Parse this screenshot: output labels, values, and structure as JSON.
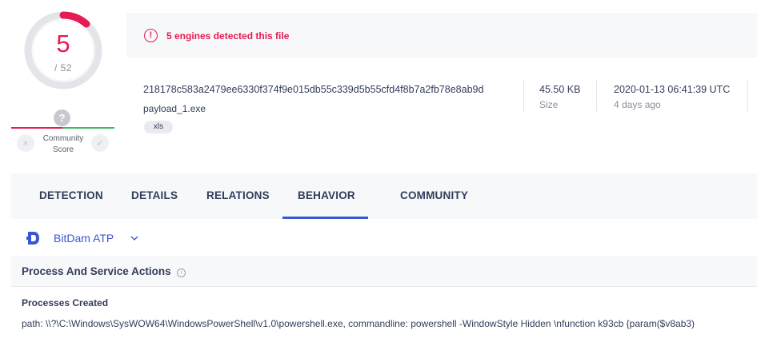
{
  "score": {
    "detections": "5",
    "total": "/ 52",
    "accent": "#e41c53"
  },
  "community": {
    "help_glyph": "?",
    "label_line1": "Community",
    "label_line2": "Score",
    "down_icon": "×",
    "up_icon": "✓"
  },
  "banner": {
    "icon": "!",
    "text": "5 engines detected this file",
    "color": "#e41c53"
  },
  "file": {
    "hash": "218178c583a2479ee6330f374f9e015db55c339d5b55cfd4f8b7a2fb78e8ab9d",
    "name": "payload_1.exe",
    "tag": "xls",
    "size_value": "45.50 KB",
    "size_label": "Size",
    "date_value": "2020-01-13 06:41:39 UTC",
    "date_relative": "4 days ago"
  },
  "tabs": [
    {
      "label": "DETECTION",
      "active": false
    },
    {
      "label": "DETAILS",
      "active": false
    },
    {
      "label": "RELATIONS",
      "active": false
    },
    {
      "label": "BEHAVIOR",
      "active": true
    },
    {
      "label": "COMMUNITY",
      "active": false
    }
  ],
  "sandbox": {
    "name": "BitDam ATP",
    "icon": "bitdam-logo-icon",
    "color": "#3a57d3"
  },
  "section": {
    "title": "Process And Service Actions",
    "info_glyph": "i",
    "subtitle": "Processes Created",
    "path_text": "path: \\\\?\\C:\\Windows\\SysWOW64\\WindowsPowerShell\\v1.0\\powershell.exe, commandline: powershell -WindowStyle Hidden \\nfunction k93cb {param($v8ab3)"
  }
}
